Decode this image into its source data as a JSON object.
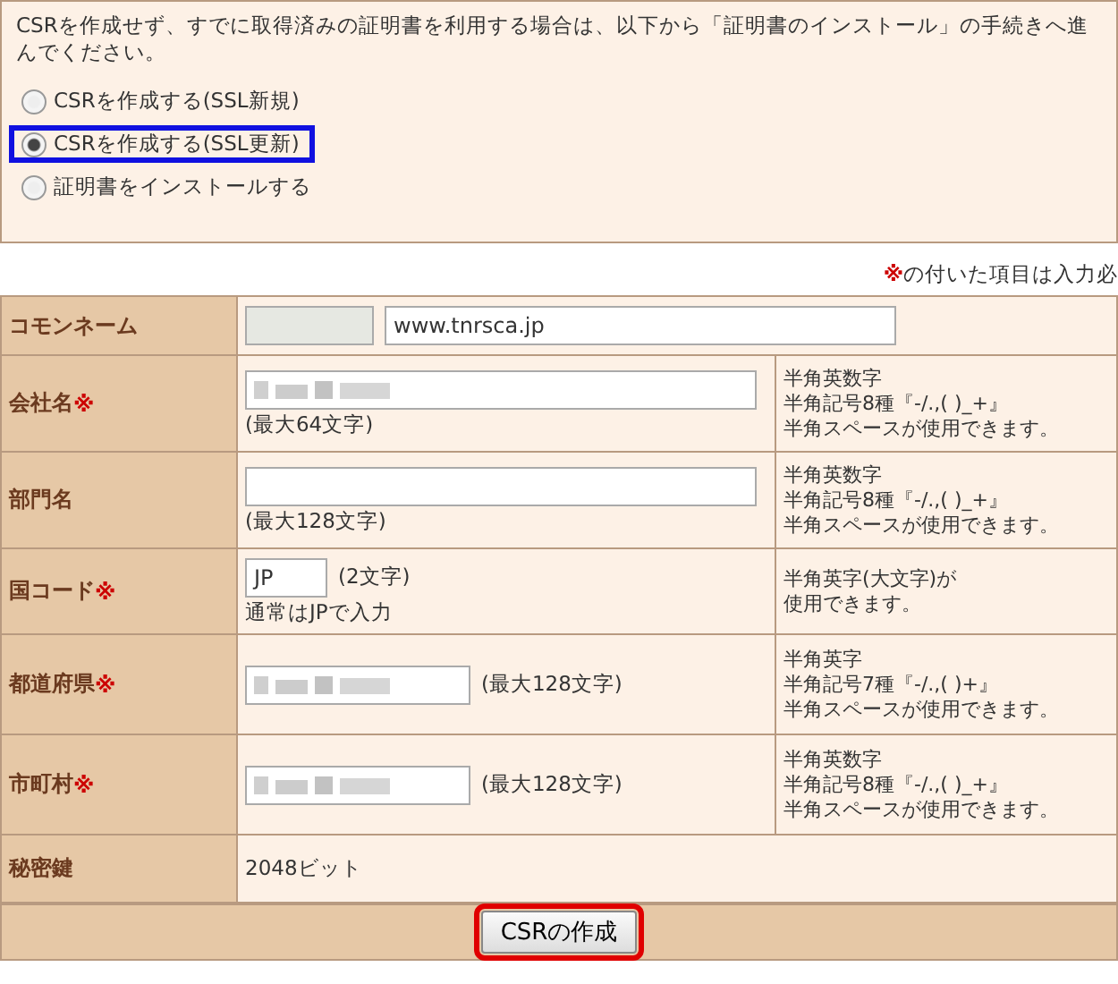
{
  "intro": "CSRを作成せず、すでに取得済みの証明書を利用する場合は、以下から「証明書のインストール」の手続きへ進んでください。",
  "options": [
    {
      "label": "CSRを作成する(SSL新規)",
      "selected": false,
      "highlighted": false
    },
    {
      "label": "CSRを作成する(SSL更新)",
      "selected": true,
      "highlighted": true
    },
    {
      "label": "証明書をインストールする",
      "selected": false,
      "highlighted": false
    }
  ],
  "required_note": {
    "mark": "※",
    "text": "の付いた項目は入力必"
  },
  "rows": [
    {
      "kind": "common_name",
      "label": "コモンネーム",
      "required": false,
      "value": "www.tnrsca.jp"
    },
    {
      "kind": "text",
      "label": "会社名",
      "required": true,
      "redacted": true,
      "note": "(最大64文字)",
      "hint": [
        "半角英数字",
        "半角記号8種『-/.,( )_+』",
        "半角スペースが使用できます。"
      ]
    },
    {
      "kind": "text",
      "label": "部門名",
      "required": false,
      "redacted": false,
      "note": "(最大128文字)",
      "hint": [
        "半角英数字",
        "半角記号8種『-/.,( )_+』",
        "半角スペースが使用できます。"
      ]
    },
    {
      "kind": "country",
      "label": "国コード",
      "required": true,
      "value": "JP",
      "note": "(2文字)",
      "sub_note": "通常はJPで入力",
      "hint": [
        "半角英字(大文字)が",
        "使用できます。"
      ]
    },
    {
      "kind": "text_inline",
      "label": "都道府県",
      "required": true,
      "redacted": true,
      "note": "(最大128文字)",
      "hint": [
        "半角英字",
        "半角記号7種『-/.,( )+』",
        "半角スペースが使用できます。"
      ]
    },
    {
      "kind": "text_inline",
      "label": "市町村",
      "required": true,
      "redacted": true,
      "note": "(最大128文字)",
      "hint": [
        "半角英数字",
        "半角記号8種『-/.,( )_+』",
        "半角スペースが使用できます。"
      ]
    },
    {
      "kind": "static",
      "label": "秘密鍵",
      "required": false,
      "value": "2048ビット"
    }
  ],
  "submit": {
    "label": "CSRの作成",
    "highlighted": true
  }
}
